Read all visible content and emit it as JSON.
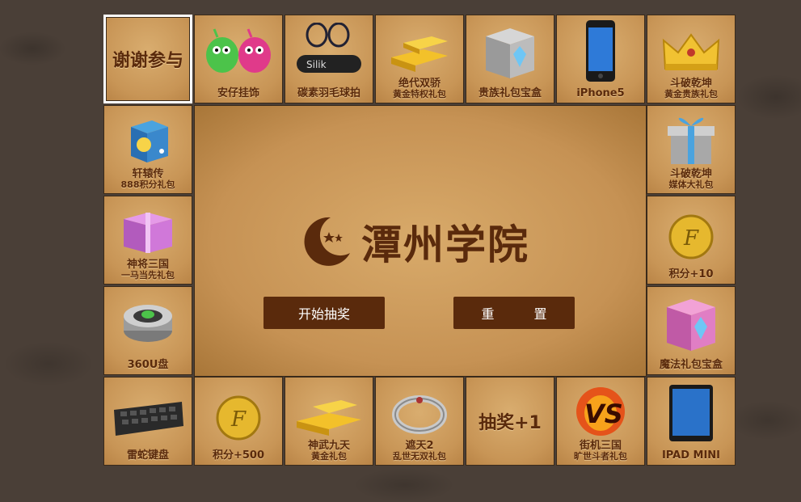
{
  "center": {
    "logo_text": "潭州学院",
    "start_button": "开始抽奖",
    "reset_button": "重 置"
  },
  "cells": {
    "c0": {
      "label": "谢谢参与"
    },
    "c1": {
      "label1": "安仔挂饰"
    },
    "c2": {
      "label1": "碳素羽毛球拍"
    },
    "c3": {
      "label1": "绝代双骄",
      "label2": "黄金特权礼包"
    },
    "c4": {
      "label1": "贵族礼包宝盒"
    },
    "c5": {
      "label1": "iPhone5"
    },
    "c6": {
      "label1": "斗破乾坤",
      "label2": "黄金贵族礼包"
    },
    "c7": {
      "label1": "斗破乾坤",
      "label2": "媒体大礼包"
    },
    "c8": {
      "label1": "积分+10"
    },
    "c9": {
      "label1": "魔法礼包宝盒"
    },
    "c10": {
      "label1": "IPAD MINI"
    },
    "c11": {
      "label1": "街机三国",
      "label2": "旷世斗者礼包"
    },
    "c12": {
      "label": "抽奖+1"
    },
    "c13": {
      "label1": "遮天2",
      "label2": "乱世无双礼包"
    },
    "c14": {
      "label1": "神武九天",
      "label2": "黄金礼包"
    },
    "c15": {
      "label1": "积分+500"
    },
    "c16": {
      "label1": "雷蛇键盘"
    },
    "c17": {
      "label1": "360U盘"
    },
    "c18": {
      "label1": "神将三国",
      "label2": "一马当先礼包"
    },
    "c19": {
      "label1": "轩辕传",
      "label2": "888积分礼包"
    }
  },
  "active_cell": "c0",
  "colors": {
    "accent": "#5a2a0c",
    "board": "#c99a5c",
    "highlight": "#ffffff"
  }
}
